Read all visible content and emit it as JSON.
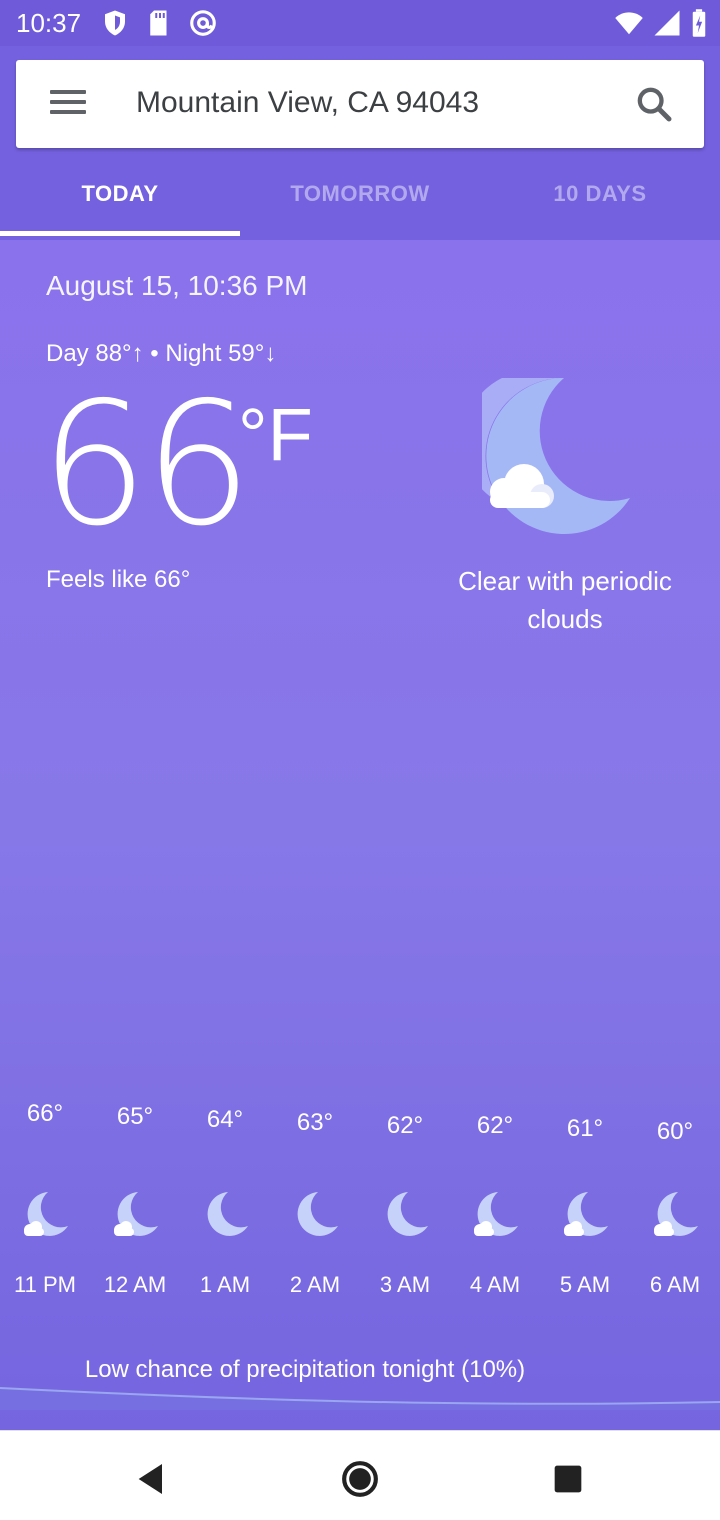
{
  "status_bar": {
    "time": "10:37",
    "icons_left": [
      "shield-icon",
      "sd-card-icon",
      "at-sign-icon"
    ],
    "icons_right": [
      "wifi-icon",
      "signal-icon",
      "battery-icon"
    ]
  },
  "search": {
    "location": "Mountain View, CA 94043"
  },
  "tabs": [
    {
      "label": "TODAY",
      "active": true
    },
    {
      "label": "TOMORROW",
      "active": false
    },
    {
      "label": "10 DAYS",
      "active": false
    }
  ],
  "current": {
    "date_time": "August 15, 10:36 PM",
    "day_night": "Day 88°↑ • Night 59°↓",
    "temperature": "66",
    "unit": "°F",
    "feels_like": "Feels like 66°",
    "condition": "Clear with periodic clouds",
    "condition_icon": "moon-cloud-icon"
  },
  "hourly": [
    {
      "temp": "66°",
      "time": "11 PM",
      "icon": "moon-cloud-icon"
    },
    {
      "temp": "65°",
      "time": "12 AM",
      "icon": "moon-cloud-icon"
    },
    {
      "temp": "64°",
      "time": "1 AM",
      "icon": "moon-icon"
    },
    {
      "temp": "63°",
      "time": "2 AM",
      "icon": "moon-icon"
    },
    {
      "temp": "62°",
      "time": "3 AM",
      "icon": "moon-icon"
    },
    {
      "temp": "62°",
      "time": "4 AM",
      "icon": "moon-cloud-icon"
    },
    {
      "temp": "61°",
      "time": "5 AM",
      "icon": "moon-cloud-icon"
    },
    {
      "temp": "60°",
      "time": "6 AM",
      "icon": "moon-cloud-icon"
    }
  ],
  "precipitation": "Low chance of precipitation tonight (10%)",
  "colors": {
    "status_bar": "#6f5bd9",
    "header": "#7461df",
    "main_top": "#8a72ec",
    "main_bottom": "#7565df"
  }
}
